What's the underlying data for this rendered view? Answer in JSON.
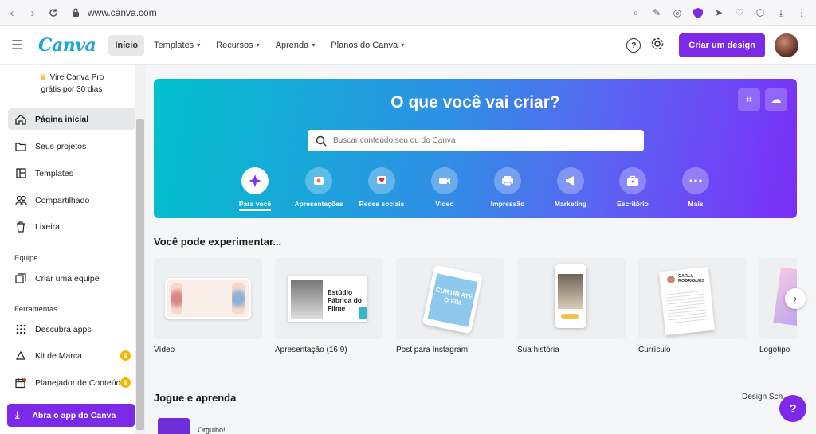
{
  "browser": {
    "url": "www.canva.com",
    "back_icon": "chevron-left-icon",
    "forward_icon": "chevron-right-icon",
    "reload_icon": "reload-icon"
  },
  "header": {
    "logo": "Canva",
    "nav": [
      {
        "label": "Início",
        "active": true
      },
      {
        "label": "Templates"
      },
      {
        "label": "Recursos"
      },
      {
        "label": "Aprenda"
      },
      {
        "label": "Planos do Canva"
      }
    ],
    "help_icon": "?",
    "create_button": "Criar um design"
  },
  "sidebar": {
    "promo_line1": "Vire Canva Pro",
    "promo_line2": "grátis por 30 dias",
    "items": [
      {
        "label": "Página inicial",
        "icon": "home-icon"
      },
      {
        "label": "Seus projetos",
        "icon": "folder-icon"
      },
      {
        "label": "Templates",
        "icon": "templates-icon"
      },
      {
        "label": "Compartilhado",
        "icon": "people-icon"
      },
      {
        "label": "Lixeira",
        "icon": "trash-icon"
      }
    ],
    "team_heading": "Equipe",
    "team_item": "Criar uma equipe",
    "tools_heading": "Ferramentas",
    "tools": [
      {
        "label": "Descubra apps",
        "icon": "apps-icon"
      },
      {
        "label": "Kit de Marca",
        "icon": "brand-kit-icon"
      },
      {
        "label": "Planejador de Conteúdo",
        "icon": "calendar-icon"
      }
    ],
    "open_app": "Abra o app do Canva"
  },
  "hero": {
    "title": "O que você vai criar?",
    "search_placeholder": "Buscar conteúdo seu ou do Canva",
    "categories": [
      {
        "label": "Para você",
        "icon": "sparkle-icon"
      },
      {
        "label": "Apresentações",
        "icon": "presentation-icon"
      },
      {
        "label": "Redes sociais",
        "icon": "heart-chat-icon"
      },
      {
        "label": "Vídeo",
        "icon": "video-icon"
      },
      {
        "label": "Impressão",
        "icon": "printer-icon"
      },
      {
        "label": "Marketing",
        "icon": "megaphone-icon"
      },
      {
        "label": "Escritório",
        "icon": "briefcase-icon"
      },
      {
        "label": "Mais",
        "icon": "more-icon"
      }
    ]
  },
  "suggestions": {
    "title": "Você pode experimentar...",
    "cards": [
      {
        "label": "Vídeo"
      },
      {
        "label": "Apresentação (16:9)",
        "thumb_text": "Estúdio Fábrica do Filme"
      },
      {
        "label": "Post para Instagram",
        "thumb_text": "CURTIR ATÉ O FIM"
      },
      {
        "label": "Sua história"
      },
      {
        "label": "Currículo",
        "thumb_text": "CARLA RODRIGUES"
      },
      {
        "label": "Logotipo"
      }
    ]
  },
  "learn": {
    "title": "Jogue e aprenda",
    "link": "Design Sch",
    "peek_label": "Orgulho!"
  },
  "colors": {
    "brand_purple": "#7d2ae8",
    "hero_start": "#00c1cb",
    "hero_end": "#7b2ff7"
  }
}
